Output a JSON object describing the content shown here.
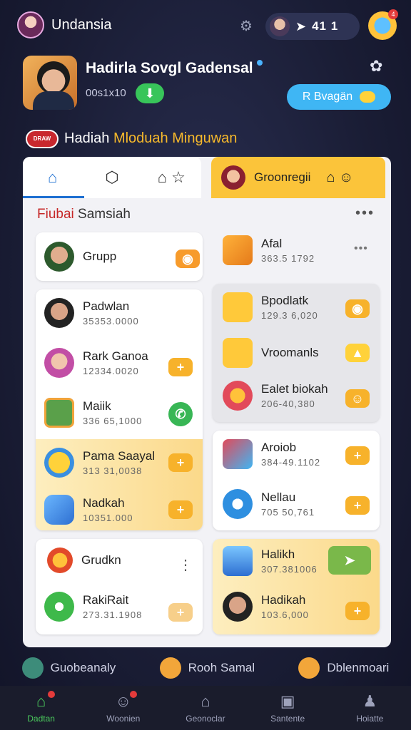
{
  "header": {
    "user_name": "Undansia",
    "status_text": "41 1",
    "badge_count": "4"
  },
  "profile": {
    "name": "Hadirla Sovgl Gadensal",
    "id": "00s1x10",
    "promo_label": "R Bvagän"
  },
  "weekly": {
    "logo_text": "DRAW",
    "title_prefix": "Hadiah",
    "title_highlight": "Mloduah Minguwan"
  },
  "tabs": {
    "group_label": "Groonregii"
  },
  "section": {
    "title_first": "Fiubai",
    "title_rest": "Samsiah"
  },
  "left_items": [
    {
      "name": "Grupp",
      "sub": ""
    },
    {
      "name": "Padwlan",
      "sub": "35353.0000"
    },
    {
      "name": "Rark Ganoa",
      "sub": "12334.0020"
    },
    {
      "name": "Maiik",
      "sub": "336 65,1000"
    },
    {
      "name": "Pama Saayal",
      "sub": "313 31,0038"
    },
    {
      "name": "Nadkah",
      "sub": "10351.000"
    },
    {
      "name": "Grudkn",
      "sub": ""
    },
    {
      "name": "RakiRait",
      "sub": "273.31.1908"
    }
  ],
  "right_items": [
    {
      "name": "Afal",
      "sub": "363.5 1792"
    },
    {
      "name": "Bpodlatk",
      "sub": "129.3 6,020"
    },
    {
      "name": "Vroomanls",
      "sub": ""
    },
    {
      "name": "Ealet biokah",
      "sub": "206-40,380"
    },
    {
      "name": "Aroiob",
      "sub": "384-49.1102"
    },
    {
      "name": "Nellau",
      "sub": "705 50,761"
    },
    {
      "name": "Halikh",
      "sub": "307.381006"
    },
    {
      "name": "Hadikah",
      "sub": "103.6,000"
    }
  ],
  "bottom_strip": [
    {
      "label": "Guobeanaly"
    },
    {
      "label": "Rooh Samal"
    },
    {
      "label": "Dblenmoari"
    }
  ],
  "nav": [
    {
      "label": "Dadtan"
    },
    {
      "label": "Woonien"
    },
    {
      "label": "Geonoclar"
    },
    {
      "label": "Santente"
    },
    {
      "label": "Hoiatte"
    }
  ],
  "colors": {
    "accent": "#f7b22b",
    "primary_blue": "#1d6fd1",
    "success": "#38c55a"
  }
}
